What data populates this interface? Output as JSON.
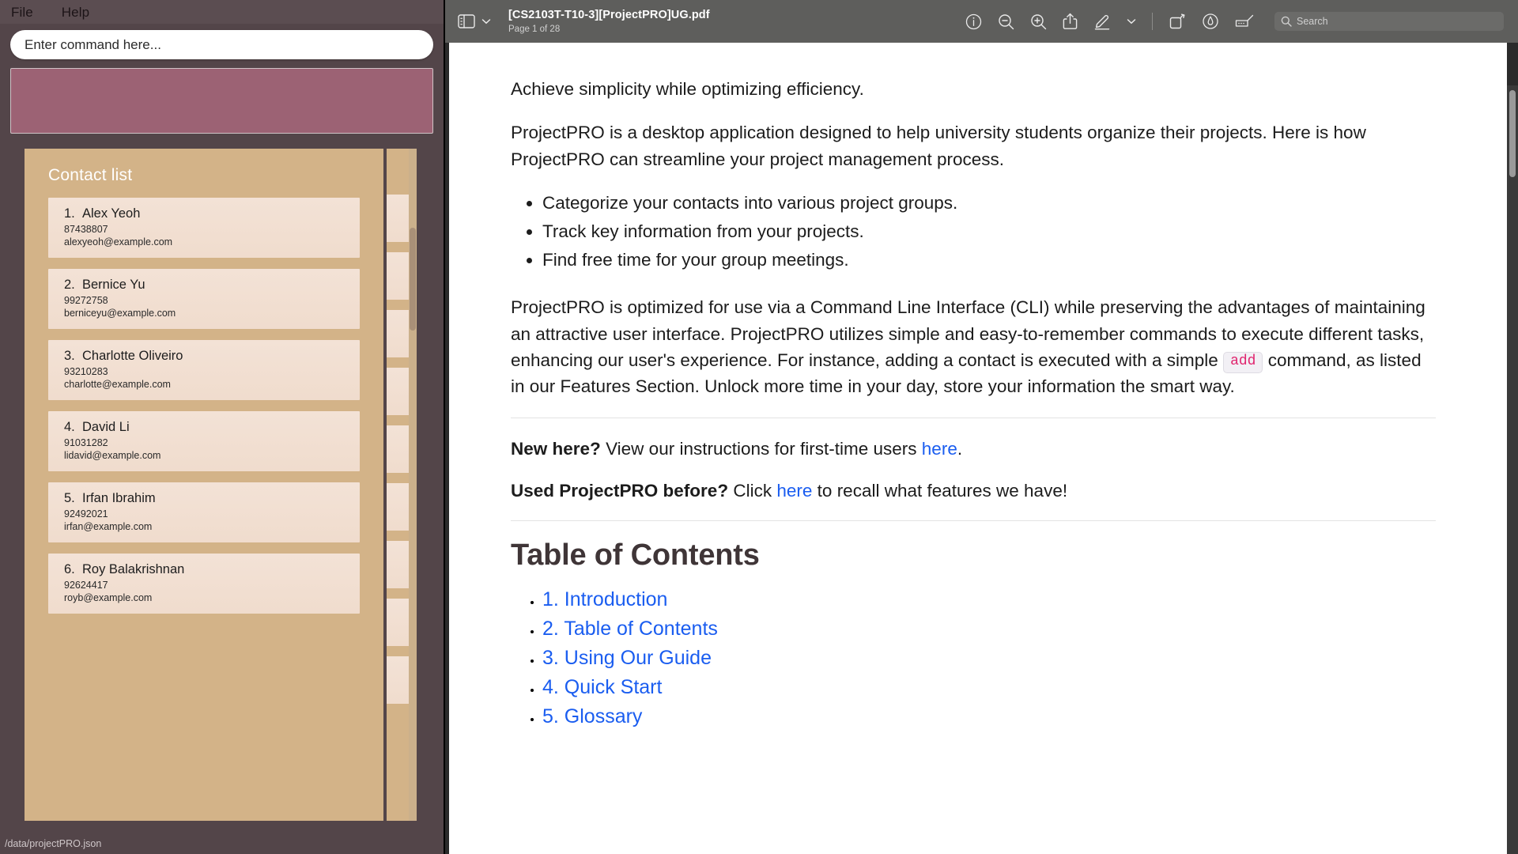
{
  "app": {
    "menu": [
      {
        "label": "File"
      },
      {
        "label": "Help"
      }
    ],
    "command_input": {
      "placeholder": "Enter command here...",
      "value": ""
    },
    "result_box": {
      "text": "",
      "color": "#9c6274"
    },
    "contact_panel": {
      "title": "Contact list",
      "accent": "#d3b388",
      "card_color": "#f0dccd",
      "contacts": [
        {
          "index": "1.",
          "name": "Alex Yeoh",
          "phone": "87438807",
          "email": "alexyeoh@example.com"
        },
        {
          "index": "2.",
          "name": "Bernice Yu",
          "phone": "99272758",
          "email": "berniceyu@example.com"
        },
        {
          "index": "3.",
          "name": "Charlotte Oliveiro",
          "phone": "93210283",
          "email": "charlotte@example.com"
        },
        {
          "index": "4.",
          "name": "David Li",
          "phone": "91031282",
          "email": "lidavid@example.com"
        },
        {
          "index": "5.",
          "name": "Irfan Ibrahim",
          "phone": "92492021",
          "email": "irfan@example.com"
        },
        {
          "index": "6.",
          "name": "Roy Balakrishnan",
          "phone": "92624417",
          "email": "royb@example.com"
        }
      ]
    },
    "status_bar": {
      "path": "/data/projectPRO.json"
    }
  },
  "pdf": {
    "toolbar": {
      "sidebar_icon": "sidebar-icon",
      "chevron_icon": "chevron-down-icon",
      "title": "[CS2103T-T10-3][ProjectPRO]UG.pdf",
      "page_status": "Page 1 of 28",
      "icons": [
        {
          "name": "info-icon"
        },
        {
          "name": "zoom-out-icon"
        },
        {
          "name": "zoom-in-icon"
        },
        {
          "name": "share-icon"
        },
        {
          "name": "markup-pen-icon"
        },
        {
          "name": "chevron-down-icon"
        },
        {
          "name": "rotate-icon"
        },
        {
          "name": "annotate-icon"
        },
        {
          "name": "redact-icon"
        }
      ],
      "search": {
        "placeholder": "Search",
        "icon": "search-icon",
        "value": ""
      }
    },
    "document": {
      "tagline": "Achieve simplicity while optimizing efficiency.",
      "intro_p1": "ProjectPRO is a desktop application designed to help university students organize their projects. Here is how ProjectPRO can streamline your project management process.",
      "bullets": [
        "Categorize your contacts into various project groups.",
        "Track key information from your projects.",
        "Find free time for your group meetings."
      ],
      "cli_p_before": "ProjectPRO is optimized for use via a Command Line Interface (CLI) while preserving the advantages of maintaining an attractive user interface. ProjectPRO utilizes simple and easy-to-remember commands to execute different tasks, enhancing our user's experience. For instance, adding a contact is executed with a simple",
      "cli_code": "add",
      "cli_p_after": "command, as listed in our Features Section. Unlock more time in your day, store your information the smart way.",
      "new_here_bold": "New here?",
      "new_here_text": "View our instructions for first-time users",
      "new_here_link": "here",
      "new_here_end": ".",
      "used_before_bold": "Used ProjectPRO before?",
      "used_before_text": "Click",
      "used_before_link": "here",
      "used_before_end": "to recall what features we have!",
      "toc_heading": "Table of Contents",
      "toc_items": [
        {
          "label": "1. Introduction"
        },
        {
          "label": "2. Table of Contents"
        },
        {
          "label": "3. Using Our Guide"
        },
        {
          "label": "4. Quick Start"
        },
        {
          "label": "5. Glossary"
        }
      ]
    }
  }
}
